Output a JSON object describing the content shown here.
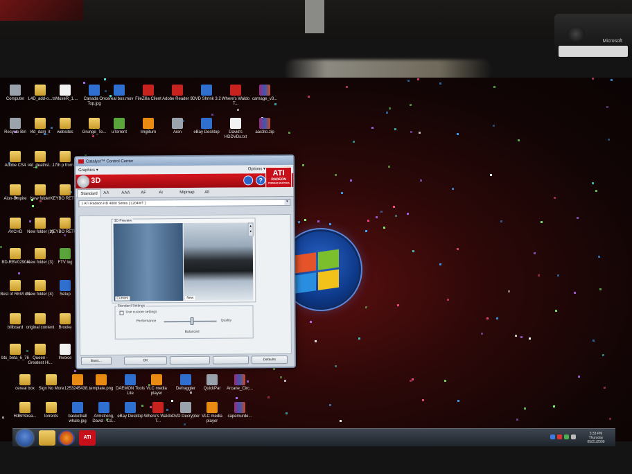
{
  "catalyst": {
    "title": "Catalyst™ Control Center",
    "menu_graphics": "Graphics ▾",
    "menu_options": "Options ▾",
    "page_title": "3D",
    "logo_brand": "ATI",
    "logo_product": "RADEON",
    "logo_sub": "PREMIUM GRAPHICS",
    "tabs": [
      "Standard",
      "AA",
      "AAA",
      "AF",
      "AI",
      "Mipmap",
      "All"
    ],
    "device_select": "1 ATI Radeon HD 4800 Series [ L204WT ]",
    "preview_title": "3D Preview",
    "preview_current": "Current",
    "preview_new": "New",
    "standard_settings_title": "Standard Settings",
    "use_custom_settings": "Use custom settings",
    "slider_left": "Performance",
    "slider_right": "Quality",
    "slider_value_label": "Balanced",
    "buttons": {
      "basic": "Basic...",
      "ok": "OK",
      "defaults": "Defaults"
    }
  },
  "desktop_icons": [
    {
      "label": "Computer",
      "type": "app-gray"
    },
    {
      "label": "L4D_add-o...",
      "type": "folder"
    },
    {
      "label": "tsMuxeR_1....",
      "type": "doc"
    },
    {
      "label": "Canada On Top.jpg",
      "type": "app-blue"
    },
    {
      "label": "cereal box.mov",
      "type": "app-blue"
    },
    {
      "label": "FileZilla Client",
      "type": "app-red"
    },
    {
      "label": "Adobe Reader 9",
      "type": "app-red"
    },
    {
      "label": "DVD Shrink 3.2",
      "type": "app-blue"
    },
    {
      "label": "Where's Waldo T...",
      "type": "app-red"
    },
    {
      "label": "carnage_v3...",
      "type": "app-rar"
    },
    {
      "label": "Recycle Bin",
      "type": "app-gray"
    },
    {
      "label": "l4d_dam_it",
      "type": "folder"
    },
    {
      "label": "websites",
      "type": "folder"
    },
    {
      "label": "Grunge_Te...",
      "type": "folder"
    },
    {
      "label": "uTorrent",
      "type": "app-green"
    },
    {
      "label": "ImgBurn",
      "type": "app-orange"
    },
    {
      "label": "Aion",
      "type": "app-gray"
    },
    {
      "label": "eBay Desktop",
      "type": "app-blue"
    },
    {
      "label": "David's HDDVDs.txt",
      "type": "doc"
    },
    {
      "label": "aac3to.zip",
      "type": "app-rar"
    },
    {
      "label": "Adobe CS4",
      "type": "folder"
    },
    {
      "label": "l4d_deathst...",
      "type": "folder"
    },
    {
      "label": "17th p from th",
      "type": "folder"
    },
    {
      "label": "Aion-Empire",
      "type": "folder"
    },
    {
      "label": "New folder",
      "type": "folder"
    },
    {
      "label": "KEYBO RETUR",
      "type": "folder"
    },
    {
      "label": "AVCHD",
      "type": "folder"
    },
    {
      "label": "New folder (2)",
      "type": "folder"
    },
    {
      "label": "KEYBO RETUR",
      "type": "folder"
    },
    {
      "label": "BD-RBV02904",
      "type": "folder"
    },
    {
      "label": "New folder (3)",
      "type": "folder"
    },
    {
      "label": "FTV log",
      "type": "app-green"
    },
    {
      "label": "Best of REM dts",
      "type": "folder"
    },
    {
      "label": "New folder (4)",
      "type": "folder"
    },
    {
      "label": "Setup",
      "type": "app-blue"
    },
    {
      "label": "billboard",
      "type": "folder"
    },
    {
      "label": "original content",
      "type": "folder"
    },
    {
      "label": "Brooke",
      "type": "folder"
    },
    {
      "label": "bts_beta_6_76",
      "type": "folder"
    },
    {
      "label": "Queen - Greatest Hi...",
      "type": "folder"
    },
    {
      "label": "Invoice",
      "type": "doc"
    },
    {
      "label": "cereal box",
      "type": "folder"
    },
    {
      "label": "Sign No More",
      "type": "folder"
    },
    {
      "label": "1253245438...",
      "type": "app-orange"
    },
    {
      "label": "template.png",
      "type": "app-orange"
    },
    {
      "label": "DAEMON Tools Lite",
      "type": "app-blue"
    },
    {
      "label": "VLC media player",
      "type": "app-orange"
    },
    {
      "label": "Defraggler",
      "type": "app-blue"
    },
    {
      "label": "QuickPar",
      "type": "app-gray"
    },
    {
      "label": "Arcane_Circ...",
      "type": "app-rar"
    },
    {
      "label": "HdBrStrea...",
      "type": "folder"
    },
    {
      "label": "torrents",
      "type": "folder"
    },
    {
      "label": "basketball whale.jpg",
      "type": "app-blue"
    },
    {
      "label": "Armstrong, David - Co...",
      "type": "app-blue"
    },
    {
      "label": "eBay Desktop",
      "type": "app-blue"
    },
    {
      "label": "Where's Waldo T...",
      "type": "app-red"
    },
    {
      "label": "DVD Decrypter",
      "type": "app-gray"
    },
    {
      "label": "VLC media player",
      "type": "app-orange"
    },
    {
      "label": "capemurde...",
      "type": "app-rar"
    }
  ],
  "taskbar": {
    "ati_label": "ATI",
    "clock_time": "3:33 PM",
    "clock_day": "Thursday",
    "clock_date": "05/21/2009"
  },
  "webcam_brand": "Microsoft"
}
